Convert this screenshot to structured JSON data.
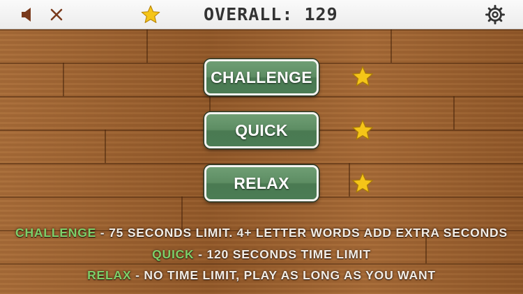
{
  "topbar": {
    "icons": [
      "speaker-icon",
      "close-icon",
      "star-icon",
      "gear-icon"
    ],
    "overall_label": "OVERALL:",
    "overall_value": "129"
  },
  "modes": [
    {
      "label": "CHALLENGE",
      "starred": true
    },
    {
      "label": "QUICK",
      "starred": true
    },
    {
      "label": "RELAX",
      "starred": true
    }
  ],
  "descriptions": [
    {
      "mode": "CHALLENGE",
      "text": "- 75 SECONDS LIMIT. 4+ LETTER WORDS ADD EXTRA SECONDS"
    },
    {
      "mode": "QUICK",
      "text": "- 120 SECONDS TIME LIMIT"
    },
    {
      "mode": "RELAX",
      "text": "- NO TIME LIMIT, PLAY AS LONG AS YOU WANT"
    }
  ],
  "colors": {
    "button_green": "#5d8d63",
    "highlight_green": "#7dd06a",
    "star_gold": "#f5c518",
    "icon_brown": "#7a3a1c"
  }
}
